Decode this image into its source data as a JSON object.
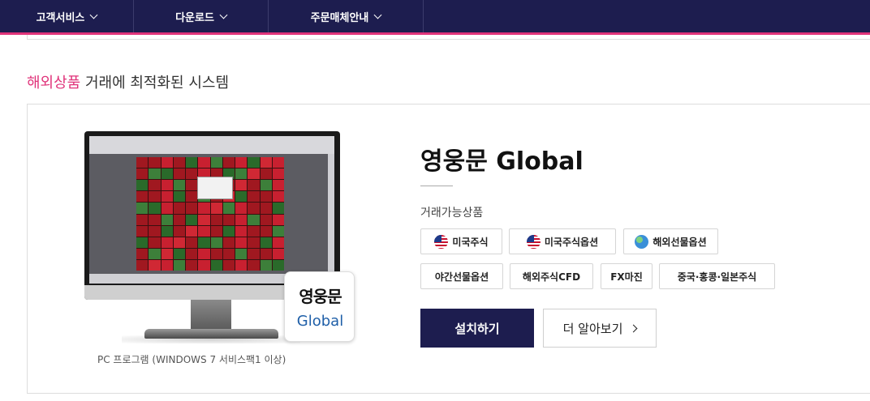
{
  "nav": {
    "items": [
      {
        "label": "고객서비스"
      },
      {
        "label": "다운로드"
      },
      {
        "label": "주문매체안내"
      }
    ]
  },
  "section": {
    "title_accent": "해외상품",
    "title_rest": " 거래에 최적화된 시스템"
  },
  "product": {
    "name": "영웅문 Global",
    "badge_hangul": "영웅문",
    "badge_global": "Global",
    "caption": "PC 프로그램 (WINDOWS 7 서비스팩1 이상)",
    "tradable_label": "거래가능상품",
    "tradable": [
      {
        "label": "미국주식",
        "icon": "us-flag-icon"
      },
      {
        "label": "미국주식옵션",
        "icon": "us-flag-icon"
      },
      {
        "label": "해외선물옵션",
        "icon": "globe-icon"
      },
      {
        "label": "야간선물옵션"
      },
      {
        "label": "해외주식CFD"
      },
      {
        "label": "FX마진"
      },
      {
        "label": "중국·홍콩·일본주식"
      }
    ],
    "install_label": "설치하기",
    "more_label": "더 알아보기"
  },
  "colors": {
    "nav_bg": "#1d1d4f",
    "accent": "#e0337a",
    "primary_button": "#1d1d4f"
  }
}
